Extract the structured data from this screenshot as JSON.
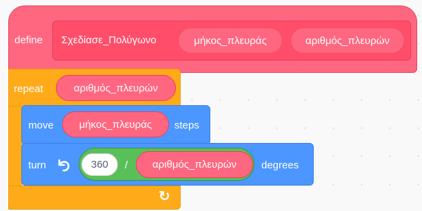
{
  "define_block": {
    "keyword": "define",
    "procedure_name": "Σχεδίασε_Πολύγωνο",
    "params": [
      "μήκος_πλευράς",
      "αριθμός_πλευρών"
    ],
    "color": "#ff6680"
  },
  "repeat_block": {
    "keyword": "repeat",
    "count_param": "αριθμός_πλευρών",
    "loop_arrow": "↻",
    "color": "#ffab19"
  },
  "move_block": {
    "keyword": "move",
    "param": "μήκος_πλευράς",
    "suffix": "steps",
    "color": "#4c97ff"
  },
  "turn_block": {
    "keyword": "turn",
    "icon": "rotate-left-icon",
    "dividend": "360",
    "operator": "/",
    "divisor_param": "αριθμός_πλευρών",
    "suffix": "degrees",
    "color": "#4c97ff",
    "operator_color": "#59c059"
  }
}
